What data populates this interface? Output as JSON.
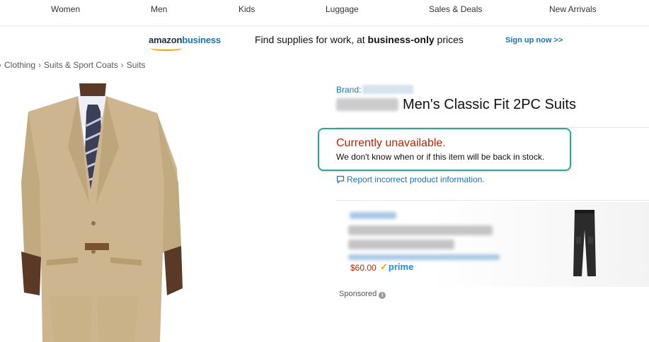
{
  "topnav": {
    "items": [
      "Women",
      "Men",
      "Kids",
      "Luggage",
      "Sales & Deals",
      "New Arrivals"
    ]
  },
  "business_banner": {
    "logo_part1": "amazon",
    "logo_part2": "business",
    "text_prefix": "Find supplies for work, at ",
    "text_bold": "business-only",
    "text_suffix": " prices",
    "link": "Sign up now >>"
  },
  "breadcrumb": {
    "items": [
      "Clothing",
      "Suits & Sport Coats",
      "Suits"
    ],
    "separator": "›"
  },
  "product": {
    "brand_label": "Brand:",
    "title": "Men's Classic Fit 2PC Suits",
    "availability_title": "Currently unavailable.",
    "availability_note": "We don't know when or if this item will be back in stock.",
    "report_link": "Report incorrect product information."
  },
  "sponsored_ad": {
    "price": "$60.00",
    "prime_label": "prime",
    "prime_check": "✓",
    "sponsored_label": "Sponsored",
    "info_icon": "i"
  },
  "colors": {
    "link": "#1a73b5",
    "unavailable": "#b12704",
    "highlight_border": "#2aa896",
    "prime": "#1a8fd6",
    "prime_check": "#f59f00"
  }
}
